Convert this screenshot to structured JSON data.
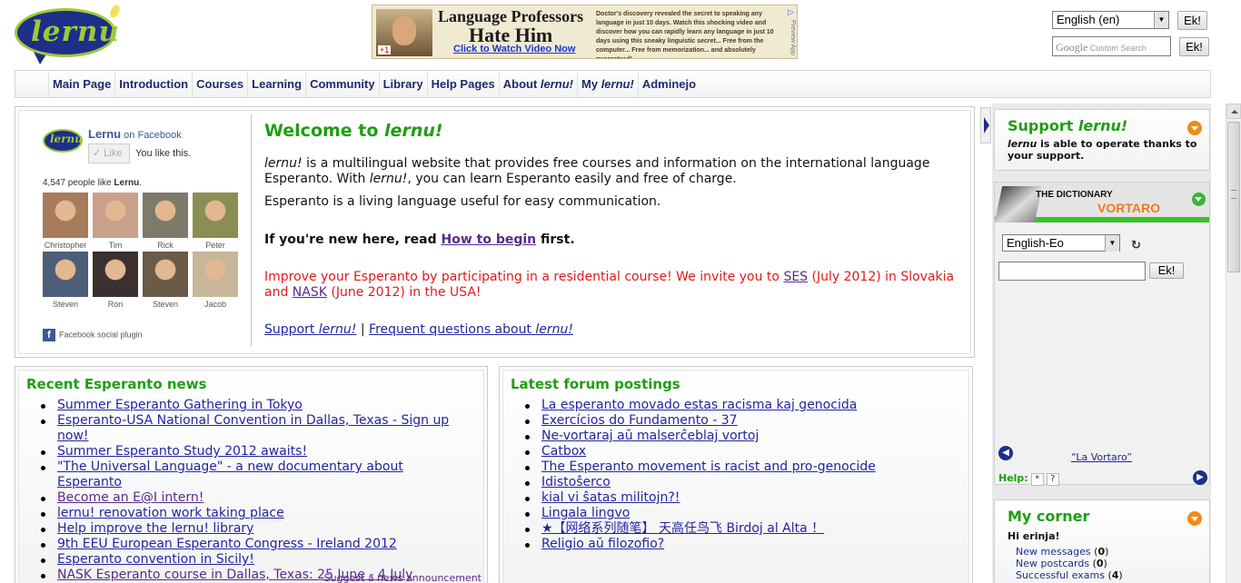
{
  "logo": {
    "text": "lernu"
  },
  "ad": {
    "headline1": "Language Professors",
    "headline2": "Hate Him",
    "link": "Click to Watch Video Now",
    "body": "Doctor's discovery revealed the secret to speaking any language in just 10 days. Watch this shocking video and discover how you can rapidly learn any language in just 10 days using this sneaky linguistic secret... Free from the computer... Free from memorization... and absolutely guaranteed!",
    "plus": "+1",
    "choices": "Preview App"
  },
  "header": {
    "language": "English (en)",
    "ek_label": "Ek!",
    "search_brand": "Google",
    "search_placeholder": "Custom Search"
  },
  "nav": [
    {
      "label": "Main Page"
    },
    {
      "label": "Introduction"
    },
    {
      "label": "Courses"
    },
    {
      "label": "Learning"
    },
    {
      "label": "Community"
    },
    {
      "label": "Library"
    },
    {
      "label": "Help Pages"
    },
    {
      "label_pre": "About ",
      "label_em": "lernu!"
    },
    {
      "label_pre": "My ",
      "label_em": "lernu!"
    },
    {
      "label": "Adminejo"
    }
  ],
  "facebook": {
    "name": "Lernu",
    "on": " on Facebook",
    "like_button": "Like",
    "you_like": "You like this.",
    "count_text": "4,547 people like ",
    "count_name": "Lernu",
    "count_end": ".",
    "fans": [
      {
        "name": "Christopher",
        "color": "#a77b5b"
      },
      {
        "name": "Tim",
        "color": "#c9a08a"
      },
      {
        "name": "Rick",
        "color": "#7d7a6a"
      },
      {
        "name": "Peter",
        "color": "#8a8e55"
      },
      {
        "name": "Steven",
        "color": "#4d5f78"
      },
      {
        "name": "Ron",
        "color": "#3a3030"
      },
      {
        "name": "Steven",
        "color": "#6a5a48"
      },
      {
        "name": "Jacob",
        "color": "#c7b69a"
      }
    ],
    "plugin_label": "Facebook social plugin"
  },
  "welcome": {
    "title_pre": "Welcome to ",
    "title_em": "lernu!",
    "p1_em": "lernu!",
    "p1_a": " is a multilingual website that provides free courses and information on the international language Esperanto. With ",
    "p1_em2": "lernu!",
    "p1_b": ", you can learn Esperanto easily and free of charge.",
    "p2": "Esperanto is a living language useful for easy communication.",
    "new_pre": "If you're new here, read ",
    "new_link": "How to begin",
    "new_post": " first.",
    "improve_pre": "Improve your Esperanto by participating in a residential course! We invite you to ",
    "ses": "SES",
    "improve_mid": " (July 2012) in Slovakia and ",
    "nask": "NASK",
    "improve_post": " (June 2012) in the USA!",
    "support_pre": "Support ",
    "support_em": "lernu!",
    "separator": " | ",
    "faq_pre": "Frequent questions about ",
    "faq_em": "lernu!"
  },
  "news": {
    "title": "Recent Esperanto news",
    "items": [
      "Summer Esperanto Gathering in Tokyo",
      "Esperanto-USA National Convention in Dallas, Texas - Sign up now!",
      "Summer Esperanto Study 2012 awaits!",
      "\"The Universal Language\" - a new documentary about Esperanto",
      "Become an E@I intern!",
      "lernu! renovation work taking place",
      "Help improve the lernu! library",
      "9th EEU European Esperanto Congress - Ireland 2012",
      "Esperanto convention in Sicily!",
      "NASK Esperanto course in Dallas, Texas: 25 June - 4 July"
    ],
    "suggest": "Suggest a news announcement"
  },
  "forum": {
    "title": "Latest forum postings",
    "items": [
      "La esperanto movado estas racisma kaj genocida",
      "Exercícios do Fundamento - 37",
      "Ne-vortaraj aŭ malserĉeblaj vortoj",
      "Catbox",
      "The Esperanto movement is racist and pro-genocide",
      "Idistoŝerco",
      "kial vi ŝatas militojn?!",
      "Lingala lingvo",
      "★【网络系列随笔】 天高任鸟飞 Birdoj al Alta ！",
      "Religio aŭ filozofio?"
    ]
  },
  "support_box": {
    "title_pre": "Support ",
    "title_em": "lernu!",
    "text_em": "lernu",
    "text": " is able to operate thanks to your support."
  },
  "dictionary": {
    "title": "THE DICTIONARY",
    "subtitle": "VORTARO",
    "language": "English-Eo",
    "swap_icon": "↻",
    "ek_label": "Ek!",
    "vortaro_link": "“La Vortaro”",
    "help_label": "Help:",
    "help_star": "*",
    "help_q": "?"
  },
  "corner": {
    "title": "My corner",
    "greeting": "Hi erinja!",
    "items": [
      {
        "label": "New messages",
        "count": "0"
      },
      {
        "label": "New postcards",
        "count": "0"
      },
      {
        "label": "Successful exams",
        "count": "4"
      }
    ]
  }
}
